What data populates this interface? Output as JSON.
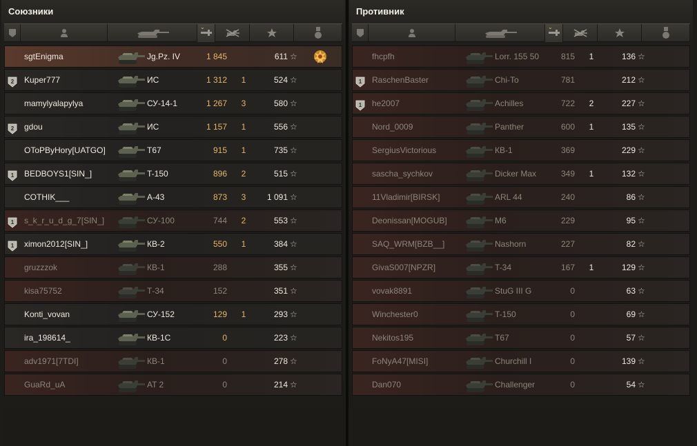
{
  "allies": {
    "title": "Союзники",
    "rows": [
      {
        "name": "sgtEnigma",
        "tank": "Jg.Pz. IV",
        "damage": "1 845",
        "kills": "",
        "xp": "611",
        "badge": "",
        "state": "me",
        "medal": true
      },
      {
        "name": "Kuper777",
        "tank": "ИС",
        "damage": "1 312",
        "kills": "1",
        "xp": "524",
        "badge": "2",
        "state": "alive"
      },
      {
        "name": "mamylyalapylya",
        "tank": "СУ-14-1",
        "damage": "1 267",
        "kills": "3",
        "xp": "580",
        "badge": "",
        "state": "alive"
      },
      {
        "name": "gdou",
        "tank": "ИС",
        "damage": "1 157",
        "kills": "1",
        "xp": "556",
        "badge": "2",
        "state": "alive"
      },
      {
        "name": "OToPByHory[UATGO]",
        "tank": "T67",
        "damage": "915",
        "kills": "1",
        "xp": "735",
        "badge": "",
        "state": "alive"
      },
      {
        "name": "BEDBOYS1[SIN_]",
        "tank": "T-150",
        "damage": "896",
        "kills": "2",
        "xp": "515",
        "badge": "1",
        "state": "alive"
      },
      {
        "name": "COTHIK___",
        "tank": "A-43",
        "damage": "873",
        "kills": "3",
        "xp": "1 091",
        "badge": "",
        "state": "alive"
      },
      {
        "name": "s_k_r_u_d_g_7[SIN_]",
        "tank": "СУ-100",
        "damage": "744",
        "kills": "2",
        "xp": "553",
        "badge": "1",
        "state": "dead"
      },
      {
        "name": "ximon2012[SIN_]",
        "tank": "КВ-2",
        "damage": "550",
        "kills": "1",
        "xp": "384",
        "badge": "1",
        "state": "alive"
      },
      {
        "name": "gruzzzok",
        "tank": "КВ-1",
        "damage": "288",
        "kills": "",
        "xp": "355",
        "badge": "",
        "state": "dead"
      },
      {
        "name": "kisa75752",
        "tank": "Т-34",
        "damage": "152",
        "kills": "",
        "xp": "351",
        "badge": "",
        "state": "dead"
      },
      {
        "name": "Konti_vovan",
        "tank": "СУ-152",
        "damage": "129",
        "kills": "1",
        "xp": "293",
        "badge": "",
        "state": "alive"
      },
      {
        "name": "ira_198614_",
        "tank": "КВ-1С",
        "damage": "0",
        "kills": "",
        "xp": "223",
        "badge": "",
        "state": "alive"
      },
      {
        "name": "adv1971[7TDI]",
        "tank": "КВ-1",
        "damage": "0",
        "kills": "",
        "xp": "278",
        "badge": "",
        "state": "dead"
      },
      {
        "name": "GuaRd_uA",
        "tank": "AT 2",
        "damage": "0",
        "kills": "",
        "xp": "214",
        "badge": "",
        "state": "dead"
      }
    ]
  },
  "enemies": {
    "title": "Противник",
    "rows": [
      {
        "name": "fhcpfh",
        "tank": "Lorr. 155 50",
        "damage": "815",
        "kills": "1",
        "xp": "136",
        "badge": "",
        "state": "dead"
      },
      {
        "name": "RaschenBaster",
        "tank": "Chi-To",
        "damage": "781",
        "kills": "",
        "xp": "212",
        "badge": "1",
        "state": "dead"
      },
      {
        "name": "he2007",
        "tank": "Achilles",
        "damage": "722",
        "kills": "2",
        "xp": "227",
        "badge": "1",
        "state": "dead"
      },
      {
        "name": "Nord_0009",
        "tank": "Panther",
        "damage": "600",
        "kills": "1",
        "xp": "135",
        "badge": "",
        "state": "dead"
      },
      {
        "name": "SergiusVictorious",
        "tank": "КВ-1",
        "damage": "369",
        "kills": "",
        "xp": "229",
        "badge": "",
        "state": "dead"
      },
      {
        "name": "sascha_sychkov",
        "tank": "Dicker Max",
        "damage": "349",
        "kills": "1",
        "xp": "132",
        "badge": "",
        "state": "dead"
      },
      {
        "name": "11Vladimir[BIRSK]",
        "tank": "ARL 44",
        "damage": "240",
        "kills": "",
        "xp": "86",
        "badge": "",
        "state": "dead"
      },
      {
        "name": "Deonissan[MOGUB]",
        "tank": "M6",
        "damage": "229",
        "kills": "",
        "xp": "95",
        "badge": "",
        "state": "dead"
      },
      {
        "name": "SAQ_WRM[BZB__]",
        "tank": "Nashorn",
        "damage": "227",
        "kills": "",
        "xp": "82",
        "badge": "",
        "state": "dead"
      },
      {
        "name": "GivaS007[NPZR]",
        "tank": "T-34",
        "damage": "167",
        "kills": "1",
        "xp": "129",
        "badge": "",
        "state": "dead"
      },
      {
        "name": "vovak8891",
        "tank": "StuG III G",
        "damage": "0",
        "kills": "",
        "xp": "63",
        "badge": "",
        "state": "dead"
      },
      {
        "name": "Winchester0",
        "tank": "T-150",
        "damage": "0",
        "kills": "",
        "xp": "69",
        "badge": "",
        "state": "dead"
      },
      {
        "name": "Nekitos195",
        "tank": "T67",
        "damage": "0",
        "kills": "",
        "xp": "57",
        "badge": "",
        "state": "dead"
      },
      {
        "name": "FoNyA47[MISI]",
        "tank": "Churchill I",
        "damage": "0",
        "kills": "",
        "xp": "139",
        "badge": "",
        "state": "dead"
      },
      {
        "name": "Dan070",
        "tank": "Challenger",
        "damage": "0",
        "kills": "",
        "xp": "54",
        "badge": "",
        "state": "dead"
      }
    ]
  },
  "header_icons": [
    "badge-icon",
    "player-icon",
    "tank-icon",
    "damage-icon",
    "kills-icon",
    "xp-star-icon",
    "medal-icon"
  ],
  "colors": {
    "background": "#1d1c19",
    "damage": "#e4b66c",
    "dead_row": "#3a2420",
    "me_row": "#5a3a2c"
  }
}
